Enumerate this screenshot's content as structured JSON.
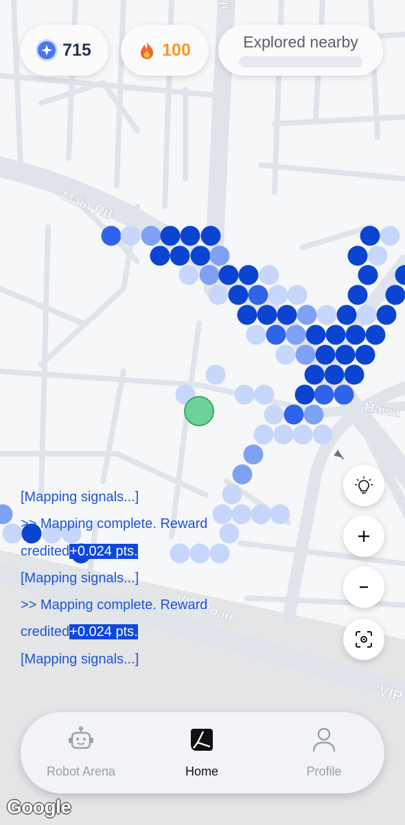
{
  "stats": {
    "gems": "715",
    "gem_icon": "blue-diamond-gem-icon",
    "streak": "100",
    "streak_icon": "fire-icon",
    "gem_color": "#3d6ef0",
    "streak_color": "#f39a25"
  },
  "explore": {
    "label": "Explored nearby",
    "progress": 0.0
  },
  "map": {
    "road_labels": [
      "Main Rd",
      "VIP Road",
      "Hawa",
      "VIP",
      "ji"
    ],
    "accent_dots_color": "#0a44d0",
    "user_marker_color": "#6fd19a"
  },
  "log": {
    "lines": [
      {
        "text": "[Mapping signals...]"
      },
      {
        "text": " >> Mapping complete. Reward"
      },
      {
        "text": "credited",
        "highlight": "+0.024 pts."
      },
      {
        "text": "[Mapping signals...]"
      },
      {
        "text": " >> Mapping complete. Reward"
      },
      {
        "text": "credited",
        "highlight": "+0.024 pts."
      },
      {
        "text": "[Mapping signals...]"
      }
    ]
  },
  "map_controls": {
    "hint_icon": "lightbulb-icon",
    "zoom_in_icon": "plus-icon",
    "zoom_out_icon": "minus-icon",
    "locate_icon": "locate-crosshair-icon"
  },
  "nav": {
    "items": [
      {
        "label": "Robot Arena",
        "icon": "robot-icon",
        "active": false
      },
      {
        "label": "Home",
        "icon": "home-map-icon",
        "active": true
      },
      {
        "label": "Profile",
        "icon": "person-icon",
        "active": false
      }
    ]
  },
  "attribution": "Google"
}
